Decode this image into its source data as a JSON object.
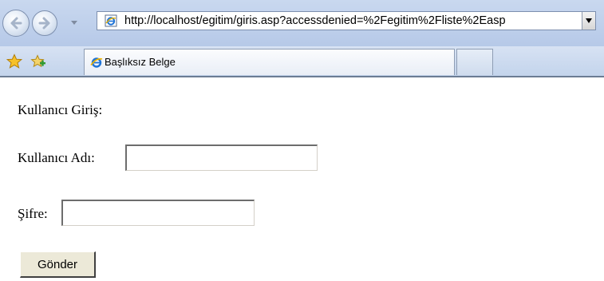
{
  "browser": {
    "address_url": "http://localhost/egitim/giris.asp?accessdenied=%2Fegitim%2Fliste%2Easp",
    "tab_title": "Başlıksız Belge",
    "icons": {
      "back": "back-arrow-icon",
      "forward": "forward-arrow-icon",
      "favorites": "favorites-star-icon",
      "add_favorites": "add-favorites-icon",
      "page": "ie-page-icon"
    }
  },
  "form": {
    "heading": "Kullanıcı Giriş:",
    "username_label": "Kullanıcı Adı:",
    "username_value": "",
    "password_label": "Şifre:",
    "password_value": "",
    "submit_label": "Gönder"
  },
  "colors": {
    "chrome": "#c9d8ef",
    "button_face": "#ece9d8"
  }
}
